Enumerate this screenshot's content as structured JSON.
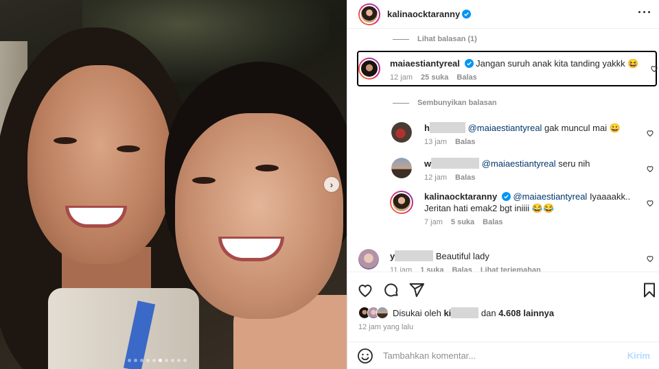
{
  "post": {
    "username": "kalinaocktaranny",
    "carousel": {
      "slide_count": 10,
      "active_index": 5
    }
  },
  "comments": {
    "view_replies": "Lihat balasan (1)",
    "hide_replies": "Sembunyikan balasan",
    "highlighted": {
      "username": "maiaestiantyreal",
      "text": "Jangan suruh anak kita tanding yakkk 😆",
      "time": "12 jam",
      "likes": "25 suka",
      "reply": "Balas"
    },
    "replies": [
      {
        "username": "h",
        "mention": "@maiaestiantyreal",
        "text": " gak muncul mai 😀",
        "time": "13 jam",
        "reply": "Balas"
      },
      {
        "username": "w",
        "mention": "@maiaestiantyreal",
        "text": " seru nih",
        "time": "12 jam",
        "reply": "Balas"
      },
      {
        "username": "kalinaocktaranny",
        "mention": "@maiaestiantyreal",
        "text": " Iyaaaakk..",
        "text2": "Jeritan hati emak2 bgt iniiii 😂😂",
        "time": "7 jam",
        "likes": "5 suka",
        "reply": "Balas"
      }
    ],
    "last": {
      "username": "y",
      "text": "Beautiful lady",
      "time": "11 jam",
      "likes": "1 suka",
      "reply": "Balas",
      "translate": "Lihat terjemahan"
    }
  },
  "likes": {
    "prefix": "Disukai oleh ",
    "user": "ki",
    "middle": " dan ",
    "count": "4.608 lainnya"
  },
  "post_time": "12 jam yang lalu",
  "add_comment": {
    "placeholder": "Tambahkan komentar...",
    "send": "Kirim"
  },
  "colors": {
    "verified": "#0095f6",
    "mention": "#00376b",
    "muted": "#8e8e8e"
  }
}
